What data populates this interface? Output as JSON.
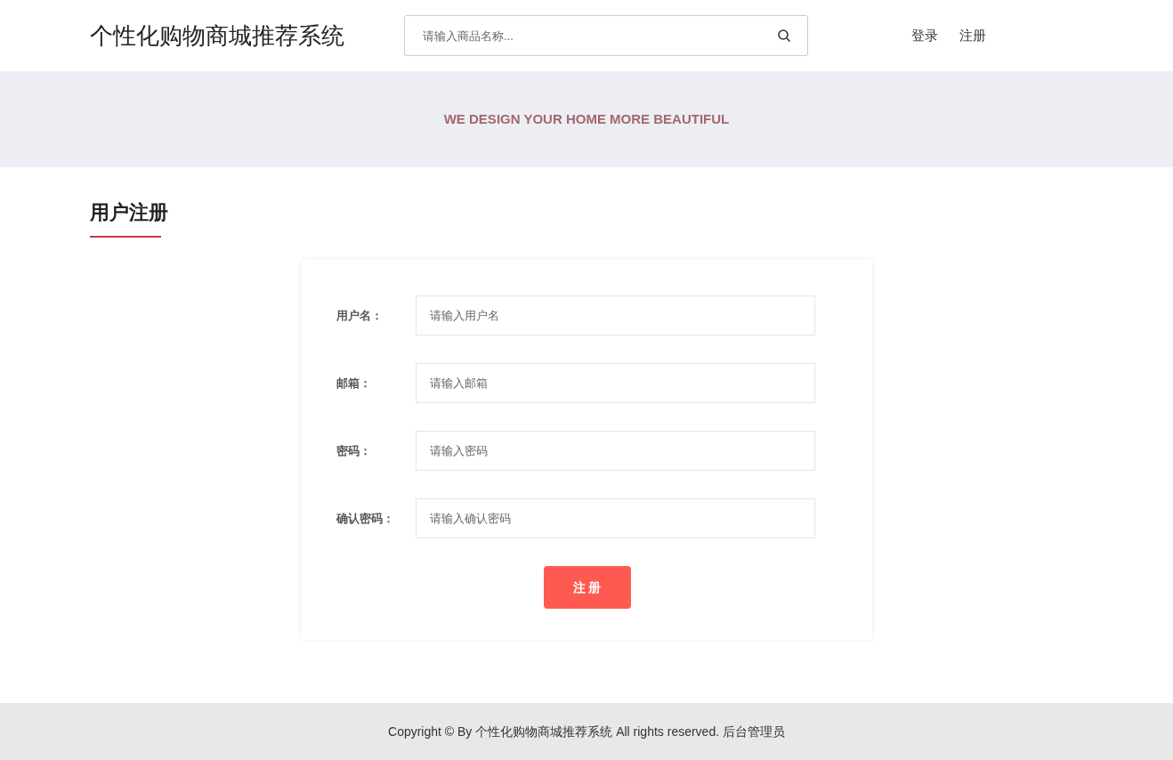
{
  "header": {
    "logo": "个性化购物商城推荐系统",
    "search": {
      "placeholder": "请输入商品名称..."
    },
    "nav_links": [
      "登录",
      "注册"
    ]
  },
  "banner": {
    "tagline": "WE DESIGN YOUR HOME MORE BEAUTIFUL"
  },
  "section_title": "用户注册",
  "form": {
    "fields": [
      {
        "label": "用户名：",
        "placeholder": "请输入用户名"
      },
      {
        "label": "邮箱：",
        "placeholder": "请输入邮箱"
      },
      {
        "label": "密码：",
        "placeholder": "请输入密码"
      },
      {
        "label": "确认密码：",
        "placeholder": "请输入确认密码"
      }
    ],
    "submit": "注 册"
  },
  "footer": {
    "text": "Copyright © By 个性化购物商城推荐系统 All rights reserved.",
    "link": "后台管理员"
  }
}
